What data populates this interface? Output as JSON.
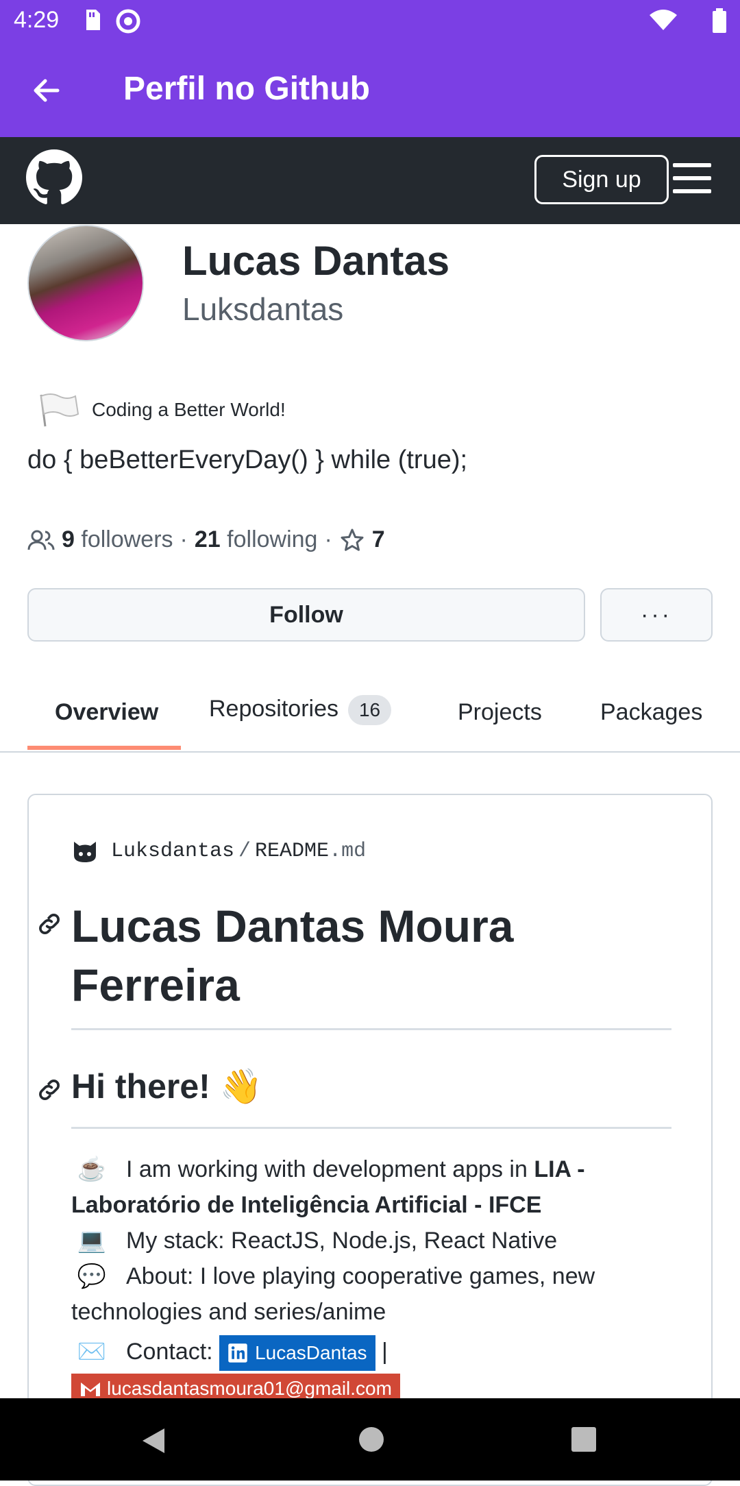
{
  "status": {
    "time": "4:29"
  },
  "appbar": {
    "title": "Perfil no Github"
  },
  "github": {
    "signup": "Sign up"
  },
  "profile": {
    "name": "Lucas Dantas",
    "login": "Luksdantas",
    "status_text": "Coding a Better World!",
    "bio": "do { beBetterEveryDay() } while (true);",
    "followers_count": "9",
    "followers_label": "followers",
    "following_count": "21",
    "following_label": "following",
    "stars": "7",
    "follow_label": "Follow",
    "more_label": "···"
  },
  "tabs": [
    {
      "label": "Overview"
    },
    {
      "label": "Repositories",
      "count": "16"
    },
    {
      "label": "Projects"
    },
    {
      "label": "Packages"
    }
  ],
  "readme": {
    "owner": "Luksdantas",
    "sep": "/",
    "file": "README",
    "ext": ".md",
    "h1": "Lucas Dantas Moura Ferreira",
    "h2": "Hi there! 👋",
    "line1_emoji": "☕",
    "line1_text": "I am working with development apps in ",
    "line1_bold": "LIA - Laboratório de Inteligência Artificial - IFCE",
    "line2_emoji": "💻",
    "line2_text": "My stack: ReactJS, Node.js, React Native",
    "line3_emoji": "💬",
    "line3_text": "About: I love playing cooperative games, new technologies and series/anime",
    "line4_emoji": "✉️",
    "line4_text": "Contact:",
    "linkedin": "LucasDantas",
    "pipe": "|",
    "gmail": "lucasdantasmoura01@gmail.com"
  }
}
